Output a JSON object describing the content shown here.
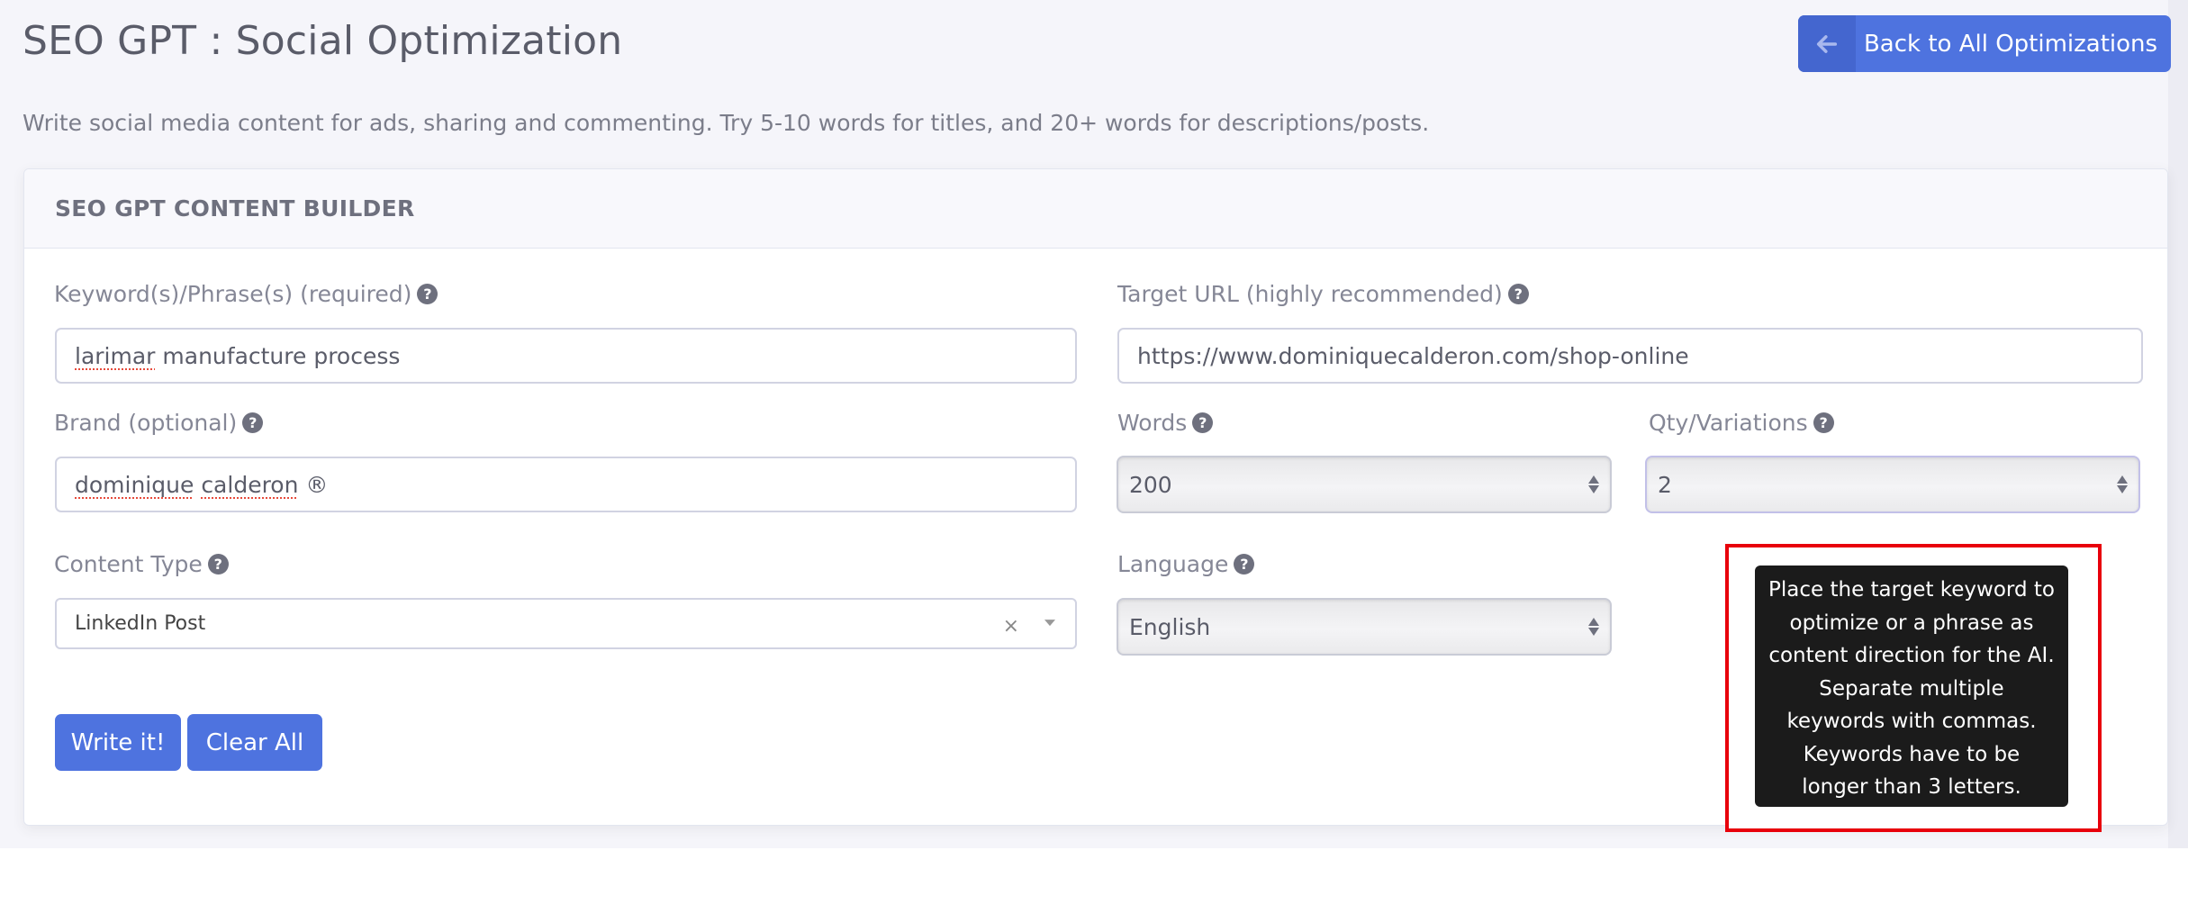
{
  "header": {
    "title": "SEO GPT : Social Optimization",
    "back_button": {
      "label": "Back to All Optimizations",
      "icon": "arrow-left-icon"
    },
    "subtitle": "Write social media content for ads, sharing and commenting. Try 5-10 words for titles, and 20+ words for descriptions/posts."
  },
  "card": {
    "title": "SEO GPT CONTENT BUILDER",
    "fields": {
      "keywords": {
        "label": "Keyword(s)/Phrase(s) (required)",
        "value_spell": "larimar",
        "value_rest": " manufacture process"
      },
      "target_url": {
        "label": "Target URL (highly recommended)",
        "value": "https://www.dominiquecalderon.com/shop-online"
      },
      "brand": {
        "label": "Brand (optional)",
        "value_spell1": "dominique",
        "value_spell2": "calderon",
        "value_rest": " ®"
      },
      "words": {
        "label": "Words",
        "value": "200"
      },
      "qty": {
        "label": "Qty/Variations",
        "value": "2"
      },
      "content_type": {
        "label": "Content Type",
        "value": "LinkedIn Post",
        "clear": "×"
      },
      "language": {
        "label": "Language",
        "value": "English"
      }
    },
    "help_glyph": "?",
    "buttons": {
      "write": "Write it!",
      "clear": "Clear All"
    }
  },
  "tooltip": {
    "text": "Place the target keyword to optimize or a phrase as content direction for the AI. Separate multiple keywords with commas. Keywords have to be longer than 3 letters."
  },
  "colors": {
    "primary": "#4e73df",
    "highlight": "#e8000b",
    "tooltip_bg": "#1b1b1b"
  }
}
